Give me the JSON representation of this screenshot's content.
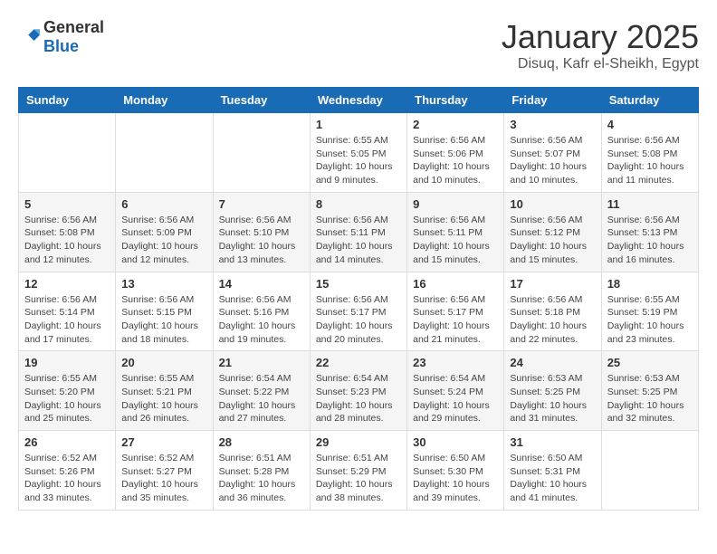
{
  "header": {
    "logo_general": "General",
    "logo_blue": "Blue",
    "title": "January 2025",
    "subtitle": "Disuq, Kafr el-Sheikh, Egypt"
  },
  "weekdays": [
    "Sunday",
    "Monday",
    "Tuesday",
    "Wednesday",
    "Thursday",
    "Friday",
    "Saturday"
  ],
  "weeks": [
    [
      {
        "day": "",
        "sunrise": "",
        "sunset": "",
        "daylight": ""
      },
      {
        "day": "",
        "sunrise": "",
        "sunset": "",
        "daylight": ""
      },
      {
        "day": "",
        "sunrise": "",
        "sunset": "",
        "daylight": ""
      },
      {
        "day": "1",
        "sunrise": "Sunrise: 6:55 AM",
        "sunset": "Sunset: 5:05 PM",
        "daylight": "Daylight: 10 hours and 9 minutes."
      },
      {
        "day": "2",
        "sunrise": "Sunrise: 6:56 AM",
        "sunset": "Sunset: 5:06 PM",
        "daylight": "Daylight: 10 hours and 10 minutes."
      },
      {
        "day": "3",
        "sunrise": "Sunrise: 6:56 AM",
        "sunset": "Sunset: 5:07 PM",
        "daylight": "Daylight: 10 hours and 10 minutes."
      },
      {
        "day": "4",
        "sunrise": "Sunrise: 6:56 AM",
        "sunset": "Sunset: 5:08 PM",
        "daylight": "Daylight: 10 hours and 11 minutes."
      }
    ],
    [
      {
        "day": "5",
        "sunrise": "Sunrise: 6:56 AM",
        "sunset": "Sunset: 5:08 PM",
        "daylight": "Daylight: 10 hours and 12 minutes."
      },
      {
        "day": "6",
        "sunrise": "Sunrise: 6:56 AM",
        "sunset": "Sunset: 5:09 PM",
        "daylight": "Daylight: 10 hours and 12 minutes."
      },
      {
        "day": "7",
        "sunrise": "Sunrise: 6:56 AM",
        "sunset": "Sunset: 5:10 PM",
        "daylight": "Daylight: 10 hours and 13 minutes."
      },
      {
        "day": "8",
        "sunrise": "Sunrise: 6:56 AM",
        "sunset": "Sunset: 5:11 PM",
        "daylight": "Daylight: 10 hours and 14 minutes."
      },
      {
        "day": "9",
        "sunrise": "Sunrise: 6:56 AM",
        "sunset": "Sunset: 5:11 PM",
        "daylight": "Daylight: 10 hours and 15 minutes."
      },
      {
        "day": "10",
        "sunrise": "Sunrise: 6:56 AM",
        "sunset": "Sunset: 5:12 PM",
        "daylight": "Daylight: 10 hours and 15 minutes."
      },
      {
        "day": "11",
        "sunrise": "Sunrise: 6:56 AM",
        "sunset": "Sunset: 5:13 PM",
        "daylight": "Daylight: 10 hours and 16 minutes."
      }
    ],
    [
      {
        "day": "12",
        "sunrise": "Sunrise: 6:56 AM",
        "sunset": "Sunset: 5:14 PM",
        "daylight": "Daylight: 10 hours and 17 minutes."
      },
      {
        "day": "13",
        "sunrise": "Sunrise: 6:56 AM",
        "sunset": "Sunset: 5:15 PM",
        "daylight": "Daylight: 10 hours and 18 minutes."
      },
      {
        "day": "14",
        "sunrise": "Sunrise: 6:56 AM",
        "sunset": "Sunset: 5:16 PM",
        "daylight": "Daylight: 10 hours and 19 minutes."
      },
      {
        "day": "15",
        "sunrise": "Sunrise: 6:56 AM",
        "sunset": "Sunset: 5:17 PM",
        "daylight": "Daylight: 10 hours and 20 minutes."
      },
      {
        "day": "16",
        "sunrise": "Sunrise: 6:56 AM",
        "sunset": "Sunset: 5:17 PM",
        "daylight": "Daylight: 10 hours and 21 minutes."
      },
      {
        "day": "17",
        "sunrise": "Sunrise: 6:56 AM",
        "sunset": "Sunset: 5:18 PM",
        "daylight": "Daylight: 10 hours and 22 minutes."
      },
      {
        "day": "18",
        "sunrise": "Sunrise: 6:55 AM",
        "sunset": "Sunset: 5:19 PM",
        "daylight": "Daylight: 10 hours and 23 minutes."
      }
    ],
    [
      {
        "day": "19",
        "sunrise": "Sunrise: 6:55 AM",
        "sunset": "Sunset: 5:20 PM",
        "daylight": "Daylight: 10 hours and 25 minutes."
      },
      {
        "day": "20",
        "sunrise": "Sunrise: 6:55 AM",
        "sunset": "Sunset: 5:21 PM",
        "daylight": "Daylight: 10 hours and 26 minutes."
      },
      {
        "day": "21",
        "sunrise": "Sunrise: 6:54 AM",
        "sunset": "Sunset: 5:22 PM",
        "daylight": "Daylight: 10 hours and 27 minutes."
      },
      {
        "day": "22",
        "sunrise": "Sunrise: 6:54 AM",
        "sunset": "Sunset: 5:23 PM",
        "daylight": "Daylight: 10 hours and 28 minutes."
      },
      {
        "day": "23",
        "sunrise": "Sunrise: 6:54 AM",
        "sunset": "Sunset: 5:24 PM",
        "daylight": "Daylight: 10 hours and 29 minutes."
      },
      {
        "day": "24",
        "sunrise": "Sunrise: 6:53 AM",
        "sunset": "Sunset: 5:25 PM",
        "daylight": "Daylight: 10 hours and 31 minutes."
      },
      {
        "day": "25",
        "sunrise": "Sunrise: 6:53 AM",
        "sunset": "Sunset: 5:25 PM",
        "daylight": "Daylight: 10 hours and 32 minutes."
      }
    ],
    [
      {
        "day": "26",
        "sunrise": "Sunrise: 6:52 AM",
        "sunset": "Sunset: 5:26 PM",
        "daylight": "Daylight: 10 hours and 33 minutes."
      },
      {
        "day": "27",
        "sunrise": "Sunrise: 6:52 AM",
        "sunset": "Sunset: 5:27 PM",
        "daylight": "Daylight: 10 hours and 35 minutes."
      },
      {
        "day": "28",
        "sunrise": "Sunrise: 6:51 AM",
        "sunset": "Sunset: 5:28 PM",
        "daylight": "Daylight: 10 hours and 36 minutes."
      },
      {
        "day": "29",
        "sunrise": "Sunrise: 6:51 AM",
        "sunset": "Sunset: 5:29 PM",
        "daylight": "Daylight: 10 hours and 38 minutes."
      },
      {
        "day": "30",
        "sunrise": "Sunrise: 6:50 AM",
        "sunset": "Sunset: 5:30 PM",
        "daylight": "Daylight: 10 hours and 39 minutes."
      },
      {
        "day": "31",
        "sunrise": "Sunrise: 6:50 AM",
        "sunset": "Sunset: 5:31 PM",
        "daylight": "Daylight: 10 hours and 41 minutes."
      },
      {
        "day": "",
        "sunrise": "",
        "sunset": "",
        "daylight": ""
      }
    ]
  ]
}
